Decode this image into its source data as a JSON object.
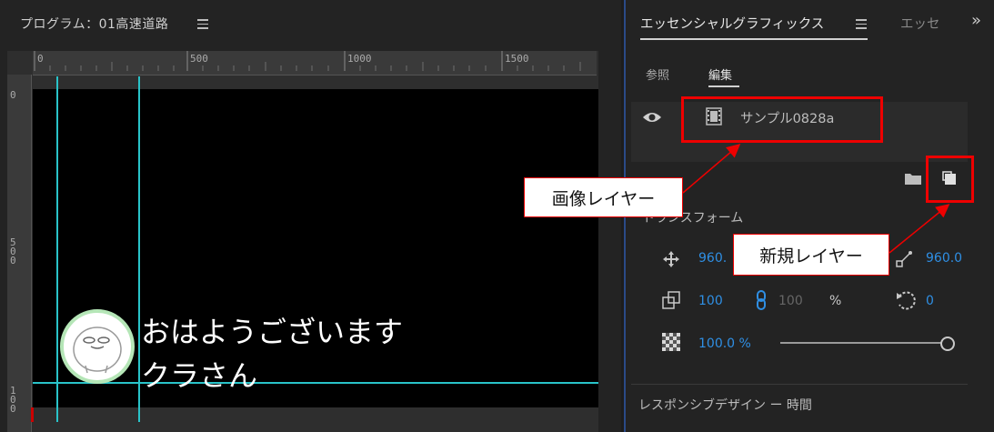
{
  "program_panel": {
    "title": "プログラム：01高速道路",
    "ruler_top_labels": [
      "0",
      "500",
      "1000",
      "1500"
    ],
    "ruler_left_labels": [
      "0",
      "5\n0\n0",
      "1\n0\n0"
    ]
  },
  "canvas": {
    "caption_line1": "おはようございます",
    "caption_line2": "クラさん",
    "guide_color": "#29c3c9"
  },
  "essential_graphics": {
    "title": "エッセンシャルグラフィックス",
    "tab2": "エッセ",
    "more": "»",
    "tabs": {
      "browse": "参照",
      "edit": "編集"
    },
    "layer_name": "サンプル0828a",
    "transform_label": "トランスフォーム",
    "position_x": "960.",
    "anchor_x": "960.0",
    "scale": "100",
    "scale_width": "100",
    "percent": "%",
    "rotation": "0",
    "opacity": "100.0 %",
    "opacity_fraction": 1.0,
    "responsive_label": "レスポンシブデザイン ー 時間"
  },
  "annotations": {
    "image_layer": "画像レイヤー",
    "new_layer": "新規レイヤー",
    "highlight_color": "#e00000"
  },
  "icons": [
    "menu-icon",
    "eye-icon",
    "film-icon",
    "folder-icon",
    "new-layer-icon",
    "move-icon",
    "anchor-icon",
    "scale-icon",
    "link-icon",
    "rotate-icon",
    "opacity-checker-icon"
  ]
}
